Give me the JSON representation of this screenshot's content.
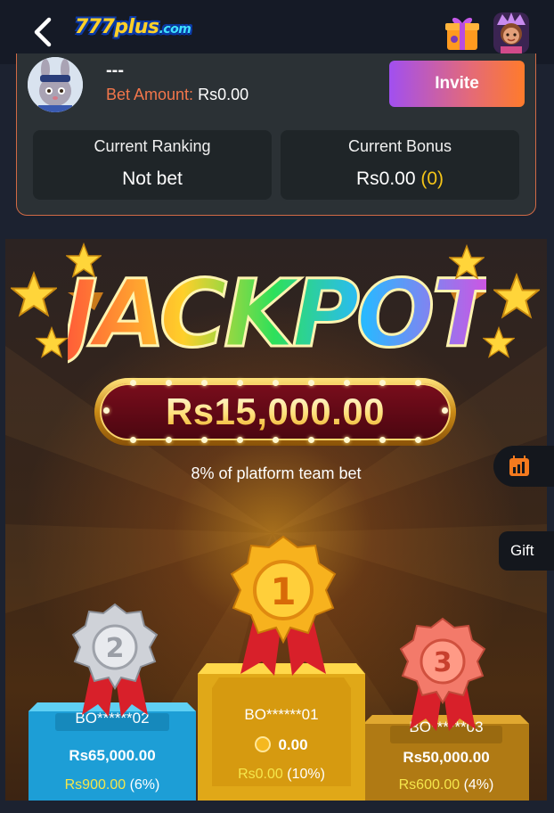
{
  "header": {
    "logo_text": "777plus",
    "logo_com": ".com",
    "back_icon": "chevron-left-icon",
    "gift_icon": "gift-box-icon"
  },
  "user": {
    "name": "---",
    "bet_label": "Bet Amount:",
    "bet_value": "Rs0.00",
    "invite_label": "Invite"
  },
  "stats": {
    "ranking_title": "Current Ranking",
    "ranking_value": "Not bet",
    "bonus_title": "Current Bonus",
    "bonus_value": "Rs0.00",
    "bonus_count": "(0)"
  },
  "jackpot": {
    "title": "JACKPOT",
    "amount": "Rs15,000.00",
    "note": "8% of platform team bet"
  },
  "side_tabs": {
    "gift_label": "Gift"
  },
  "podium": {
    "first": {
      "rank": "1",
      "name": "BO******01",
      "amount": "0.00",
      "bonus_value": "Rs0.00",
      "bonus_pct": "(10%)"
    },
    "second": {
      "rank": "2",
      "name": "BO******02",
      "amount": "Rs65,000.00",
      "bonus_value": "Rs900.00",
      "bonus_pct": "(6%)"
    },
    "third": {
      "rank": "3",
      "name": "BO******03",
      "amount": "Rs50,000.00",
      "bonus_value": "Rs600.00",
      "bonus_pct": "(4%)"
    }
  },
  "colors": {
    "accent_orange": "#f2764b",
    "bonus_yellow": "#f5e64b",
    "invite_gradient_start": "#a14ff0",
    "invite_gradient_end": "#ff7b2b"
  }
}
